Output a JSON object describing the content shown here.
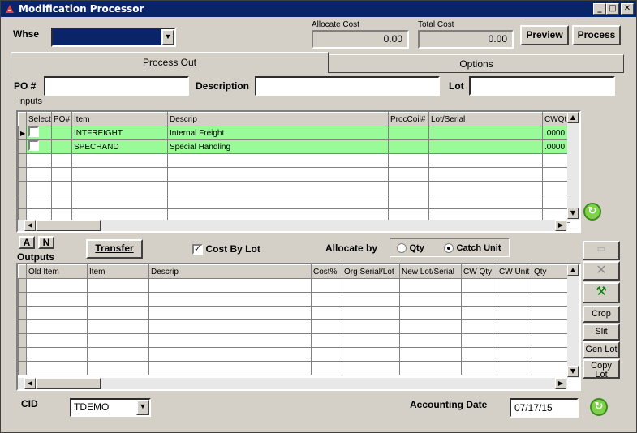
{
  "window": {
    "title": "Modification Processor"
  },
  "header": {
    "whse_label": "Whse",
    "whse_value": "",
    "allocate_cost_label": "Allocate Cost",
    "allocate_cost_value": "0.00",
    "total_cost_label": "Total Cost",
    "total_cost_value": "0.00",
    "preview_label": "Preview",
    "process_label": "Process"
  },
  "tabs": [
    {
      "label": "Process Out",
      "active": true
    },
    {
      "label": "Options",
      "active": false
    }
  ],
  "filters": {
    "po_label": "PO #",
    "po_value": "",
    "description_label": "Description",
    "description_value": "",
    "lot_label": "Lot",
    "lot_value": ""
  },
  "inputs": {
    "section_label": "Inputs",
    "columns": [
      "Select",
      "PO#",
      "Item",
      "Descrip",
      "ProcCoil#",
      "Lot/Serial",
      "CWQt"
    ],
    "rows": [
      {
        "item": "INTFREIGHT",
        "descrip": "Internal Freight",
        "cwqt": ".0000"
      },
      {
        "item": "SPECHAND",
        "descrip": "Special Handling",
        "cwqt": ".0000"
      }
    ]
  },
  "mid_controls": {
    "a_label": "A",
    "n_label": "N",
    "outputs_label": "Outputs",
    "transfer_label": "Transfer",
    "cost_by_lot_label": "Cost By Lot",
    "cost_by_lot_checked": true,
    "allocate_by_label": "Allocate by",
    "qty_label": "Qty",
    "catch_unit_label": "Catch Unit",
    "allocate_by_selected": "Catch Unit"
  },
  "outputs": {
    "columns": [
      "Old Item",
      "Item",
      "Descrip",
      "Cost%",
      "Org Serial/Lot",
      "New Lot/Serial",
      "CW Qty",
      "CW Unit",
      "Qty"
    ]
  },
  "side_buttons": {
    "crop": "Crop",
    "slit": "Slit",
    "gen_lot": "Gen Lot",
    "copy_lot": "Copy Lot"
  },
  "footer": {
    "cid_label": "CID",
    "cid_value": "TDEMO",
    "accounting_date_label": "Accounting Date",
    "accounting_date_value": "07/17/15"
  },
  "colors": {
    "title_bar": "#0a246a",
    "row_highlight": "#98fb98",
    "selection": "#0a246a"
  }
}
